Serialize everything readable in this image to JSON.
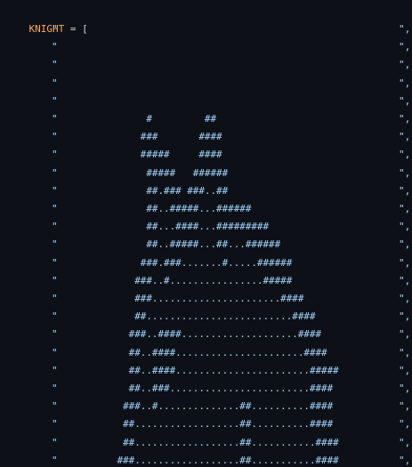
{
  "declaration": {
    "identifier": "KNIGHT",
    "operator": " = ",
    "bracket": "["
  },
  "quote_open": "\"",
  "quote_close": "\",",
  "art_lines": [
    "",
    "",
    "",
    "",
    "",
    "               #         ##",
    "              ###       ####",
    "              #####     ####",
    "               #####   ######",
    "               ##.### ###..##",
    "               ##..#####...######",
    "               ##...####...#########",
    "               ##..#####...##...######",
    "              ###.###.......#.....######",
    "             ###..#................#####",
    "             ###......................####",
    "             ##.........................####",
    "            ###..####....................####",
    "            ##..####......................####",
    "            ##..####.......................#####",
    "            ##..###........................####",
    "           ###..#..............##..........####",
    "           ##..................##..........####",
    "           ##..................##...........####",
    "          ###..................##...........####"
  ]
}
